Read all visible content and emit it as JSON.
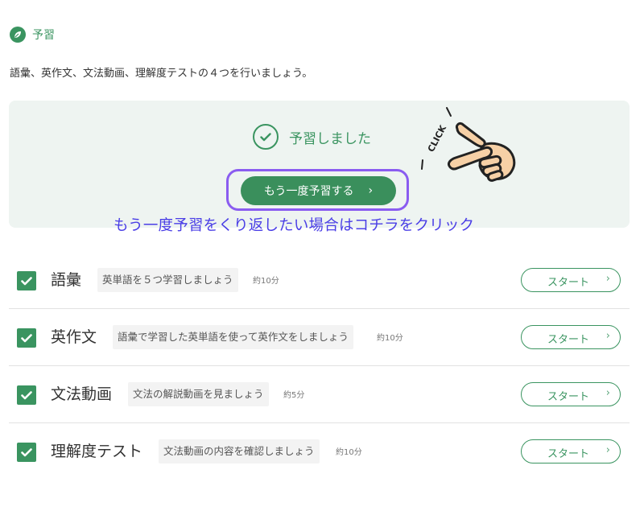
{
  "section": {
    "title": "予習",
    "icon": "leaf-icon"
  },
  "intro": "語彙、英作文、文法動画、理解度テストの４つを行いましょう。",
  "status": {
    "done_label": "予習しました",
    "redo_button": "もう一度予習する",
    "chevron": "›"
  },
  "hint": "もう一度予習をくり返したい場合はコチラをクリック",
  "overlay": {
    "click_text": "CLICK"
  },
  "colors": {
    "accent": "#3a9460",
    "highlight": "#8a5cf0",
    "hint_text": "#4a3ee6"
  },
  "tasks": [
    {
      "name": "語彙",
      "description": "英単語を５つ学習しましょう",
      "time": "約10分",
      "start": "スタート",
      "checked": true
    },
    {
      "name": "英作文",
      "description": "語彙で学習した英単語を使って英作文をしましょう",
      "time": "約10分",
      "start": "スタート",
      "checked": true
    },
    {
      "name": "文法動画",
      "description": "文法の解説動画を見ましょう",
      "time": "約5分",
      "start": "スタート",
      "checked": true
    },
    {
      "name": "理解度テスト",
      "description": "文法動画の内容を確認しましょう",
      "time": "約10分",
      "start": "スタート",
      "checked": true
    }
  ]
}
